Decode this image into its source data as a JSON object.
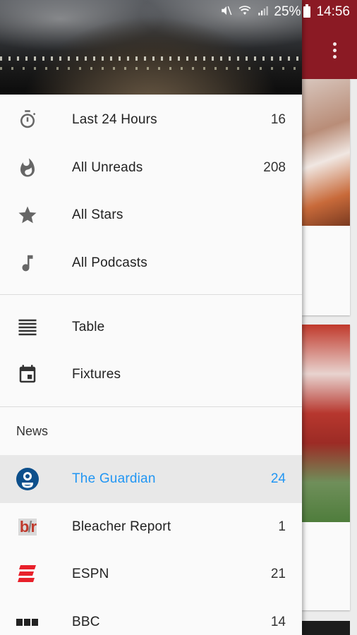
{
  "status_bar": {
    "battery": "25%",
    "time": "14:56"
  },
  "drawer": {
    "smart_items": [
      {
        "label": "Last 24 Hours",
        "count": "16",
        "icon": "stopwatch-icon"
      },
      {
        "label": "All Unreads",
        "count": "208",
        "icon": "flame-icon"
      },
      {
        "label": "All Stars",
        "count": "",
        "icon": "star-icon"
      },
      {
        "label": "All Podcasts",
        "count": "",
        "icon": "music-note-icon"
      }
    ],
    "sport_items": [
      {
        "label": "Table",
        "icon": "table-lines-icon"
      },
      {
        "label": "Fixtures",
        "icon": "calendar-icon"
      }
    ],
    "section_title": "News",
    "feeds": [
      {
        "label": "The Guardian",
        "count": "24",
        "icon": "guardian-logo-icon",
        "active": true
      },
      {
        "label": "Bleacher Report",
        "count": "1",
        "icon": "bleacher-report-logo-icon"
      },
      {
        "label": "ESPN",
        "count": "21",
        "icon": "espn-logo-icon"
      },
      {
        "label": "BBC",
        "count": "14",
        "icon": "bbc-logo-icon"
      }
    ]
  },
  "colors": {
    "accent": "#2196f3",
    "toolbar": "#8b1a24",
    "espn_red": "#e8202a",
    "guardian_blue": "#0d4f8b"
  }
}
